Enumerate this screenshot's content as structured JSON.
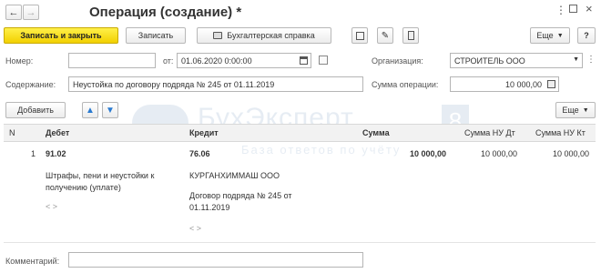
{
  "window": {
    "title": "Операция (создание) *"
  },
  "toolbar": {
    "post_close": "Записать и закрыть",
    "save": "Записать",
    "accounting_report": "Бухгалтерская справка",
    "more": "Еще",
    "help": "?"
  },
  "form": {
    "number_label": "Номер:",
    "number_value": "",
    "date_from_label": "от:",
    "date_value": "01.06.2020  0:00:00",
    "organization_label": "Организация:",
    "organization_value": "СТРОИТЕЛЬ ООО",
    "content_label": "Содержание:",
    "content_value": "Неустойка по договору подряда № 245 от 01.11.2019",
    "amount_label": "Сумма операции:",
    "amount_value": "10 000,00",
    "comment_label": "Комментарий:",
    "comment_value": ""
  },
  "table_toolbar": {
    "add": "Добавить",
    "more": "Еще"
  },
  "table": {
    "headers": {
      "n": "N",
      "debit": "Дебет",
      "credit": "Кредит",
      "sum": "Сумма",
      "sum_nu_dt": "Сумма НУ Дт",
      "sum_nu_kt": "Сумма НУ Кт"
    },
    "rows": [
      {
        "n": "1",
        "debit_account": "91.02",
        "debit_sub1": "Штрафы, пени и неустойки к",
        "debit_sub2": "получению (уплате)",
        "debit_sub3": "< >",
        "credit_account": "76.06",
        "credit_sub1": "КУРГАНХИММАШ ООО",
        "credit_sub2": "Договор подряда № 245 от",
        "credit_sub3": "01.11.2019",
        "credit_sub4": "< >",
        "sum": "10 000,00",
        "sum_nu_dt": "10 000,00",
        "sum_nu_kt": "10 000,00"
      }
    ]
  },
  "watermark": {
    "brand": "БухЭксперт",
    "digit": "8",
    "tagline": "База ответов по учёту"
  }
}
